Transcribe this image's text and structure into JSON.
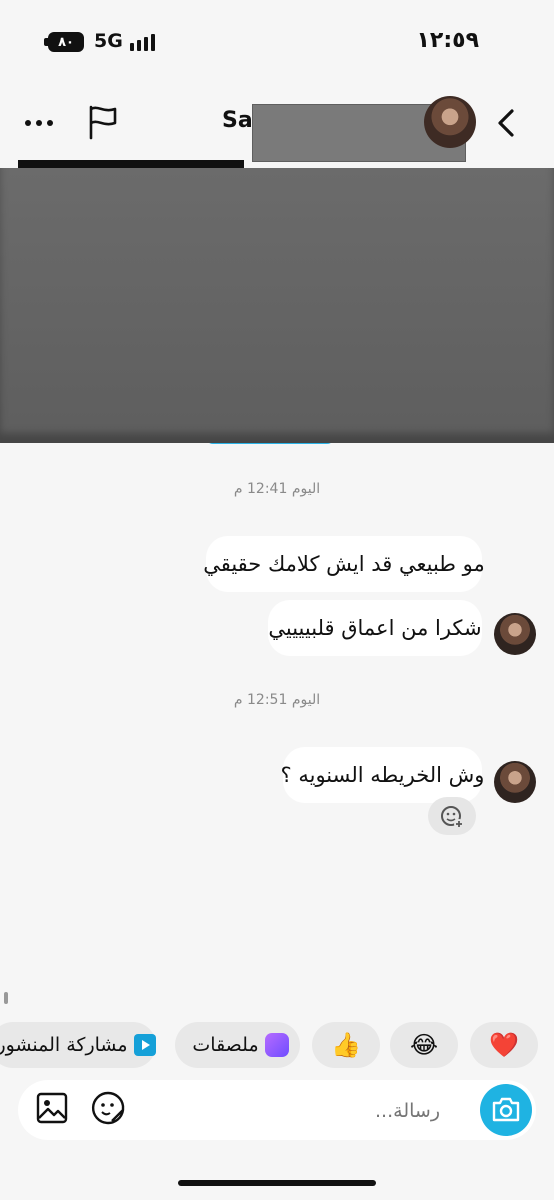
{
  "status_bar": {
    "battery": "٨٠",
    "network": "5G",
    "time": "١٢:٥٩"
  },
  "header": {
    "contact_name_partial": "Sal"
  },
  "messages": {
    "time_1": "اليوم 12:41 م",
    "msg_1": "مو طبيعي قد ايش كلامك حقيقي",
    "msg_2": "شكرا من اعماق قلبييييي",
    "time_2": "اليوم 12:51 م",
    "msg_3": "وش الخريطه السنويه ؟"
  },
  "quick_actions": {
    "heart": "❤️",
    "laugh": "😂",
    "thumbs_up": "👍",
    "stickers_label": "ملصقات",
    "share_post_label": "مشاركة المنشور"
  },
  "composer": {
    "placeholder": "رسالة..."
  },
  "icons": {
    "more": "more-icon",
    "flag": "flag-icon",
    "back": "chevron-right-icon",
    "gallery": "gallery-icon",
    "sticker": "sticker-icon",
    "camera": "camera-icon",
    "add_reaction": "add-reaction-icon"
  },
  "colors": {
    "accent_blue": "#1fb3e2",
    "bubble": "#ffffff",
    "background": "#f6f6f6"
  }
}
